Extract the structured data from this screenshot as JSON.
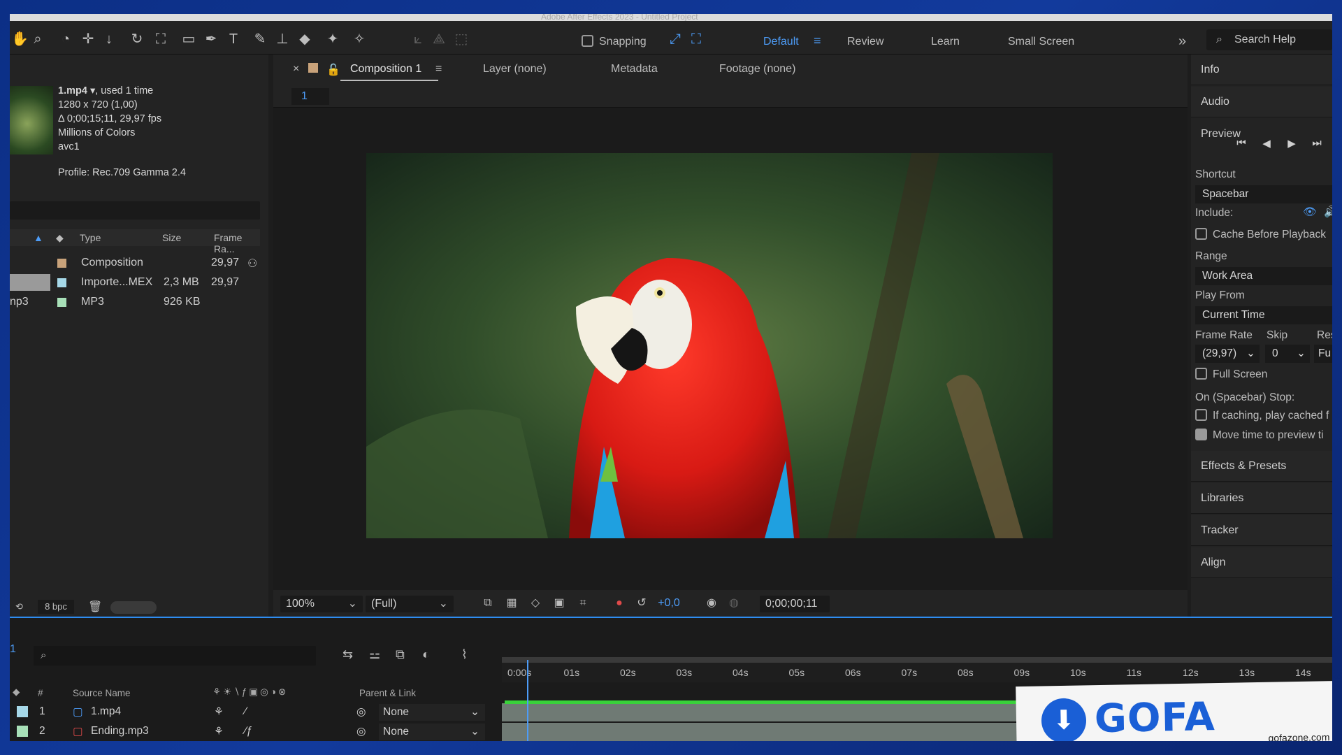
{
  "window": {
    "title": "Adobe After Effects 2023 - Untitled Project"
  },
  "toolbar": {
    "snapping_label": "Snapping",
    "workspaces": [
      "Default",
      "Review",
      "Learn",
      "Small Screen"
    ],
    "search_placeholder": "Search Help"
  },
  "project": {
    "file_name": "1.mp4",
    "used": ", used 1 time",
    "dimensions": "1280 x 720 (1,00)",
    "duration": "Δ 0;00;15;11, 29,97 fps",
    "colors": "Millions of Colors",
    "codec": "avc1",
    "profile": "Profile: Rec.709 Gamma 2.4",
    "columns": {
      "type": "Type",
      "size": "Size",
      "frame_rate": "Frame Ra..."
    },
    "items": [
      {
        "name": "",
        "type": "Composition",
        "size": "",
        "fps": "29,97",
        "color": "#c8a27a"
      },
      {
        "name": "",
        "type": "Importe...MEX",
        "size": "2,3 MB",
        "fps": "29,97",
        "color": "#a6d8e8"
      },
      {
        "name": "np3",
        "type": "MP3",
        "size": "926 KB",
        "fps": "",
        "color": "#a8e0b8"
      }
    ],
    "bpc": "8 bpc"
  },
  "composition": {
    "tab_active": "Composition 1",
    "tabs": [
      "Layer (none)",
      "Metadata",
      "Footage (none)"
    ],
    "subtab": "1",
    "zoom": "100%",
    "resolution": "(Full)",
    "exposure": "+0,0",
    "timecode": "0;00;00;11"
  },
  "right_panel": {
    "sections_top": [
      "Info",
      "Audio",
      "Preview"
    ],
    "shortcut_label": "Shortcut",
    "shortcut_value": "Spacebar",
    "include_label": "Include:",
    "cache_label": "Cache Before Playback",
    "range_label": "Range",
    "range_value": "Work Area",
    "play_from_label": "Play From",
    "play_from_value": "Current Time",
    "frame_rate_label": "Frame Rate",
    "skip_label": "Skip",
    "res_label": "Res",
    "frame_rate_value": "(29,97)",
    "skip_value": "0",
    "res_value": "Fu",
    "full_screen_label": "Full Screen",
    "stop_label": "On (Spacebar) Stop:",
    "if_caching_label": "If caching, play cached f",
    "move_time_label": "Move time to preview ti",
    "sections_bottom": [
      "Effects & Presets",
      "Libraries",
      "Tracker",
      "Align"
    ]
  },
  "timeline": {
    "comp_index": "1",
    "columns": {
      "num": "#",
      "source": "Source Name",
      "parent": "Parent & Link"
    },
    "ticks": [
      "0:00s",
      "01s",
      "02s",
      "03s",
      "04s",
      "05s",
      "06s",
      "07s",
      "08s",
      "09s",
      "10s",
      "11s",
      "12s",
      "13s",
      "14s"
    ],
    "layers": [
      {
        "num": "1",
        "name": "1.mp4",
        "parent": "None"
      },
      {
        "num": "2",
        "name": "Ending.mp3",
        "parent": "None"
      }
    ]
  },
  "watermark": {
    "brand": "GOFA ZONE",
    "url": "gofazone.com"
  }
}
